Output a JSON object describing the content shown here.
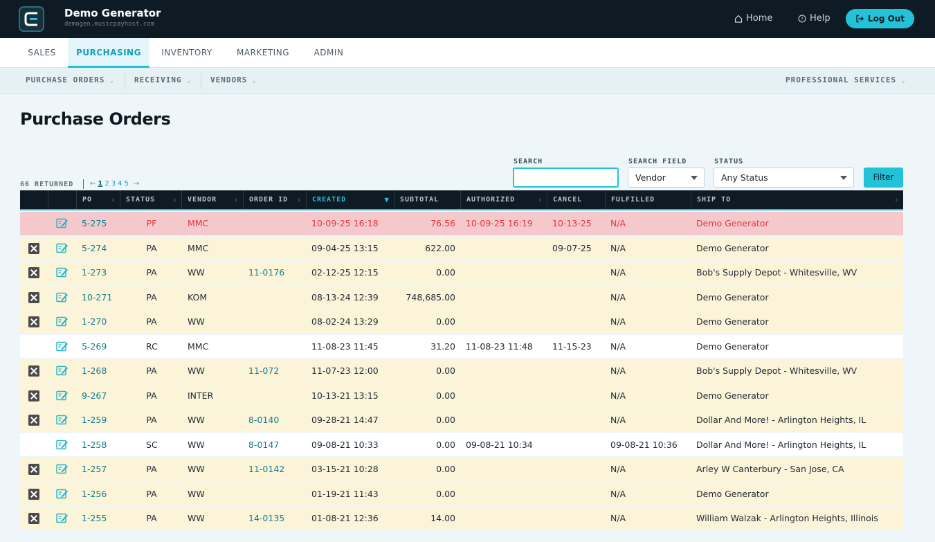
{
  "app": {
    "name": "Demo Generator",
    "host": "demogen.musicpayhost.com",
    "home_label": "Home",
    "help_label": "Help",
    "logout_label": "Log Out"
  },
  "main_tabs": [
    "SALES",
    "PURCHASING",
    "INVENTORY",
    "MARKETING",
    "ADMIN"
  ],
  "active_tab": "PURCHASING",
  "sub_nav": {
    "left": [
      "PURCHASE ORDERS",
      "RECEIVING",
      "VENDORS"
    ],
    "right": "PROFESSIONAL SERVICES"
  },
  "page_title": "Purchase Orders",
  "filters": {
    "search_label": "SEARCH",
    "search_value": "",
    "search_field_label": "SEARCH FIELD",
    "search_field_value": "Vendor",
    "status_label": "STATUS",
    "status_value": "Any Status",
    "filter_button": "Filter"
  },
  "results": {
    "returned_text": "66 RETURNED",
    "prev": "←",
    "next": "→",
    "pages": [
      "1",
      "2",
      "3",
      "4",
      "5"
    ],
    "current_page": "1"
  },
  "table": {
    "columns": [
      "PO",
      "STATUS",
      "VENDOR",
      "ORDER ID",
      "CREATED",
      "SUBTOTAL",
      "AUTHORIZED",
      "CANCEL",
      "FULFILLED",
      "SHIP TO"
    ],
    "sorted_column": "CREATED",
    "rows": [
      {
        "style": "red",
        "deletable": false,
        "po": "5-275",
        "status": "PF",
        "vendor": "MMC",
        "order_id": "",
        "created": "10-09-25 16:18",
        "subtotal": "76.56",
        "authorized": "10-09-25 16:19",
        "cancel": "10-13-25",
        "fulfilled": "N/A",
        "ship_to": "Demo Generator"
      },
      {
        "style": "yellow",
        "deletable": true,
        "po": "5-274",
        "status": "PA",
        "vendor": "MMC",
        "order_id": "",
        "created": "09-04-25 13:15",
        "subtotal": "622.00",
        "authorized": "",
        "cancel": "09-07-25",
        "fulfilled": "N/A",
        "ship_to": "Demo Generator"
      },
      {
        "style": "yellow",
        "deletable": true,
        "po": "1-273",
        "status": "PA",
        "vendor": "WW",
        "order_id": "11-0176",
        "created": "02-12-25 12:15",
        "subtotal": "0.00",
        "authorized": "",
        "cancel": "",
        "fulfilled": "N/A",
        "ship_to": "Bob's Supply Depot - Whitesville, WV"
      },
      {
        "style": "yellow",
        "deletable": true,
        "po": "10-271",
        "status": "PA",
        "vendor": "KOM",
        "order_id": "",
        "created": "08-13-24 12:39",
        "subtotal": "748,685.00",
        "authorized": "",
        "cancel": "",
        "fulfilled": "N/A",
        "ship_to": "Demo Generator"
      },
      {
        "style": "yellow",
        "deletable": true,
        "po": "1-270",
        "status": "PA",
        "vendor": "WW",
        "order_id": "",
        "created": "08-02-24 13:29",
        "subtotal": "0.00",
        "authorized": "",
        "cancel": "",
        "fulfilled": "N/A",
        "ship_to": "Demo Generator"
      },
      {
        "style": "white",
        "deletable": false,
        "po": "5-269",
        "status": "RC",
        "vendor": "MMC",
        "order_id": "",
        "created": "11-08-23 11:45",
        "subtotal": "31.20",
        "authorized": "11-08-23 11:48",
        "cancel": "11-15-23",
        "fulfilled": "N/A",
        "ship_to": "Demo Generator"
      },
      {
        "style": "yellow",
        "deletable": true,
        "po": "1-268",
        "status": "PA",
        "vendor": "WW",
        "order_id": "11-072",
        "created": "11-07-23 12:00",
        "subtotal": "0.00",
        "authorized": "",
        "cancel": "",
        "fulfilled": "N/A",
        "ship_to": "Bob's Supply Depot - Whitesville, WV"
      },
      {
        "style": "yellow",
        "deletable": true,
        "po": "9-267",
        "status": "PA",
        "vendor": "INTER",
        "order_id": "",
        "created": "10-13-21 13:15",
        "subtotal": "0.00",
        "authorized": "",
        "cancel": "",
        "fulfilled": "N/A",
        "ship_to": "Demo Generator"
      },
      {
        "style": "yellow",
        "deletable": true,
        "po": "1-259",
        "status": "PA",
        "vendor": "WW",
        "order_id": "8-0140",
        "created": "09-28-21 14:47",
        "subtotal": "0.00",
        "authorized": "",
        "cancel": "",
        "fulfilled": "N/A",
        "ship_to": "Dollar And More! - Arlington Heights, IL"
      },
      {
        "style": "white",
        "deletable": false,
        "po": "1-258",
        "status": "SC",
        "vendor": "WW",
        "order_id": "8-0147",
        "created": "09-08-21 10:33",
        "subtotal": "0.00",
        "authorized": "09-08-21 10:34",
        "cancel": "",
        "fulfilled": "09-08-21 10:36",
        "ship_to": "Dollar And More! - Arlington Heights, IL"
      },
      {
        "style": "yellow",
        "deletable": true,
        "po": "1-257",
        "status": "PA",
        "vendor": "WW",
        "order_id": "11-0142",
        "created": "03-15-21 10:28",
        "subtotal": "0.00",
        "authorized": "",
        "cancel": "",
        "fulfilled": "N/A",
        "ship_to": "Arley W Canterbury - San Jose, CA"
      },
      {
        "style": "yellow",
        "deletable": true,
        "po": "1-256",
        "status": "PA",
        "vendor": "WW",
        "order_id": "",
        "created": "01-19-21 11:43",
        "subtotal": "0.00",
        "authorized": "",
        "cancel": "",
        "fulfilled": "N/A",
        "ship_to": "Demo Generator"
      },
      {
        "style": "yellow",
        "deletable": true,
        "po": "1-255",
        "status": "PA",
        "vendor": "WW",
        "order_id": "14-0135",
        "created": "01-08-21 12:36",
        "subtotal": "14.00",
        "authorized": "",
        "cancel": "",
        "fulfilled": "N/A",
        "ship_to": "William Walzak - Arlington Heights, Illinois"
      }
    ]
  },
  "colors": {
    "accent": "#22c2d8",
    "dark": "#0e1a24",
    "row_pending": "#fbf4d9",
    "row_alert": "#f5c9cc"
  }
}
